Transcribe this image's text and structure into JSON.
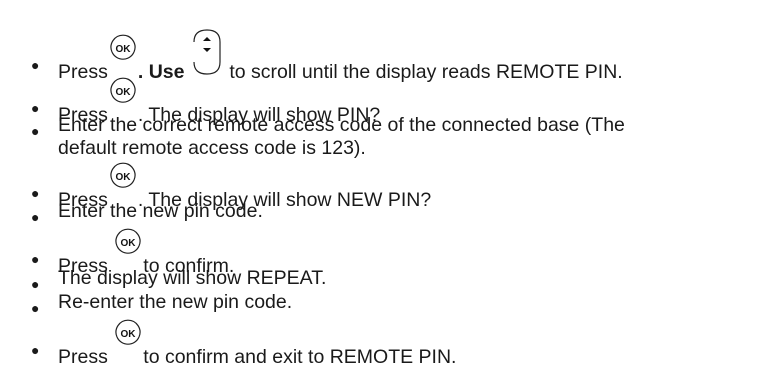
{
  "steps": [
    {
      "pre": "Press",
      "mid": ". Use",
      "post": "to scroll until the display reads REMOTE PIN."
    },
    {
      "pre": "Press",
      "post": ". The display will show PIN?"
    },
    {
      "line1": "Enter the correct remote access code of the connected base (The",
      "line2": "default remote access code is 123)."
    },
    {
      "pre": "Press",
      "post": ". The display will show NEW PIN?"
    },
    {
      "text": "Enter the new pin code."
    },
    {
      "pre": "Press",
      "post": "to confirm."
    },
    {
      "text": "The display will show REPEAT."
    },
    {
      "text": "Re-enter the new pin code."
    },
    {
      "pre": "Press",
      "post": "to confirm and exit to REMOTE PIN."
    }
  ],
  "icons": {
    "ok_label": "OK",
    "ok_name": "ok-button-icon",
    "nav_name": "up-down-navigation-icon"
  }
}
